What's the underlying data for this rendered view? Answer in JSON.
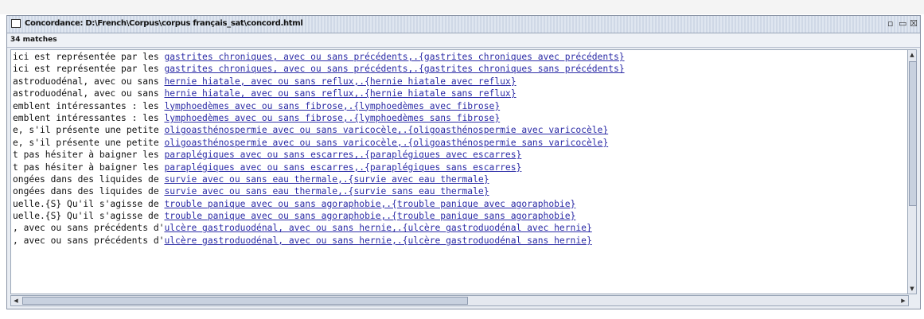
{
  "window": {
    "title": "Concordance: D:\\French\\Corpus\\corpus français_sat\\concord.html",
    "matches_label": "34 matches",
    "controls": [
      "▫",
      "▭",
      "☒"
    ]
  },
  "rows": [
    {
      "left": "ici est représentée par les ",
      "match": "gastrites chroniques, avec ou sans précédents,.{gastrites chroniques avec précédents}"
    },
    {
      "left": "ici est représentée par les ",
      "match": "gastrites chroniques, avec ou sans précédents,.{gastrites chroniques sans précédents}"
    },
    {
      "left": "astroduodénal, avec ou sans ",
      "match": "hernie hiatale, avec ou sans reflux,.{hernie hiatale avec reflux}"
    },
    {
      "left": "astroduodénal, avec ou sans ",
      "match": "hernie hiatale, avec ou sans reflux,.{hernie hiatale sans reflux}"
    },
    {
      "left": "emblent intéressantes : les ",
      "match": "lymphoedèmes avec ou sans fibrose,.{lymphoedèmes avec fibrose}"
    },
    {
      "left": "emblent intéressantes : les ",
      "match": "lymphoedèmes avec ou sans fibrose,.{lymphoedèmes sans fibrose}"
    },
    {
      "left": "e, s'il présente une petite ",
      "match": "oligoasthénospermie avec ou sans varicocèle,.{oligoasthénospermie avec varicocèle}"
    },
    {
      "left": "e, s'il présente une petite ",
      "match": "oligoasthénospermie avec ou sans varicocèle,.{oligoasthénospermie sans varicocèle}"
    },
    {
      "left": "t pas hésiter à baigner les ",
      "match": "paraplégiques avec ou sans escarres,.{paraplégiques avec escarres}"
    },
    {
      "left": "t pas hésiter à baigner les ",
      "match": "paraplégiques avec ou sans escarres,.{paraplégiques sans escarres}"
    },
    {
      "left": "ongées dans des liquides de ",
      "match": "survie avec ou sans eau thermale,.{survie avec eau thermale}"
    },
    {
      "left": "ongées dans des liquides de ",
      "match": "survie avec ou sans eau thermale,.{survie sans eau thermale}"
    },
    {
      "left": "uelle.{S} Qu'il s'agisse de ",
      "match": "trouble panique avec ou sans agoraphobie,.{trouble panique avec agoraphobie}"
    },
    {
      "left": "uelle.{S} Qu'il s'agisse de ",
      "match": "trouble panique avec ou sans agoraphobie,.{trouble panique sans agoraphobie}"
    },
    {
      "left": ", avec ou sans précédents d'",
      "match": "ulcère gastroduodénal, avec ou sans hernie,.{ulcère gastroduodénal avec hernie}"
    },
    {
      "left": ", avec ou sans précédents d'",
      "match": "ulcère gastroduodénal, avec ou sans hernie,.{ulcère gastroduodénal sans hernie}"
    },
    {
      "left": "",
      "match": ""
    }
  ]
}
